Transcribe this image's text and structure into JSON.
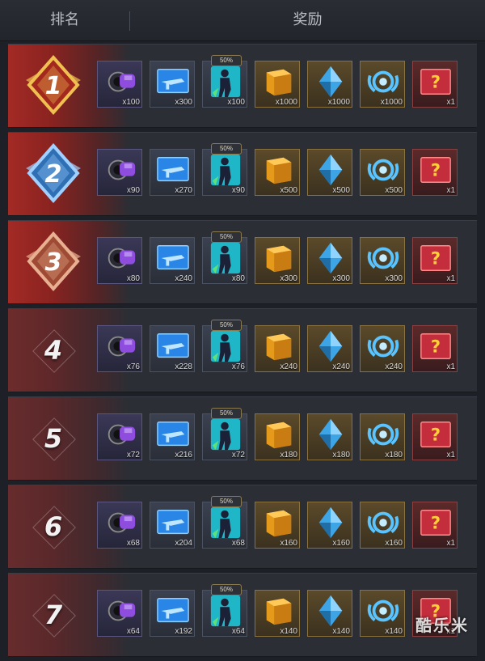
{
  "header": {
    "rank_label": "排名",
    "reward_label": "奖励"
  },
  "items": [
    {
      "icon": "purple-scope-icon"
    },
    {
      "icon": "blue-weapon-card-icon"
    },
    {
      "icon": "character-card-icon",
      "badge": "50%"
    },
    {
      "icon": "gold-crate-icon"
    },
    {
      "icon": "blue-crystal-icon"
    },
    {
      "icon": "blue-emblem-icon"
    },
    {
      "icon": "mystery-card-icon"
    }
  ],
  "rows": [
    {
      "rank": "1",
      "medal": "gold",
      "quantities": [
        "x100",
        "x300",
        "x100",
        "x1000",
        "x1000",
        "x1000",
        "x1"
      ]
    },
    {
      "rank": "2",
      "medal": "silver",
      "quantities": [
        "x90",
        "x270",
        "x90",
        "x500",
        "x500",
        "x500",
        "x1"
      ]
    },
    {
      "rank": "3",
      "medal": "bronze",
      "quantities": [
        "x80",
        "x240",
        "x80",
        "x300",
        "x300",
        "x300",
        "x1"
      ]
    },
    {
      "rank": "4",
      "medal": "none",
      "quantities": [
        "x76",
        "x228",
        "x76",
        "x240",
        "x240",
        "x240",
        "x1"
      ]
    },
    {
      "rank": "5",
      "medal": "none",
      "quantities": [
        "x72",
        "x216",
        "x72",
        "x180",
        "x180",
        "x180",
        "x1"
      ]
    },
    {
      "rank": "6",
      "medal": "none",
      "quantities": [
        "x68",
        "x204",
        "x68",
        "x160",
        "x160",
        "x160",
        "x1"
      ]
    },
    {
      "rank": "7",
      "medal": "none",
      "quantities": [
        "x64",
        "x192",
        "x64",
        "x140",
        "x140",
        "x140",
        "x1"
      ]
    }
  ],
  "watermark": "酷乐米",
  "colors": {
    "accent_red": "#a32a25",
    "gold": "#e0b040",
    "silver": "#6aa8e0",
    "bronze": "#c8825a"
  }
}
